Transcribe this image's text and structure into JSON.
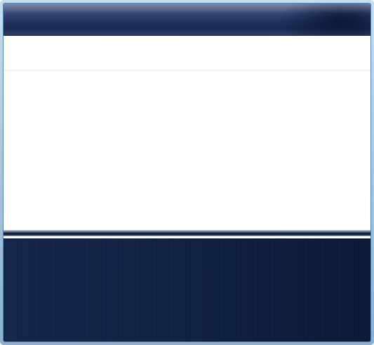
{
  "window": {
    "title": ""
  },
  "colors": {
    "title_bar": "#22345f",
    "footer_panel": "#102143",
    "frame_border": "#4f86b6"
  }
}
